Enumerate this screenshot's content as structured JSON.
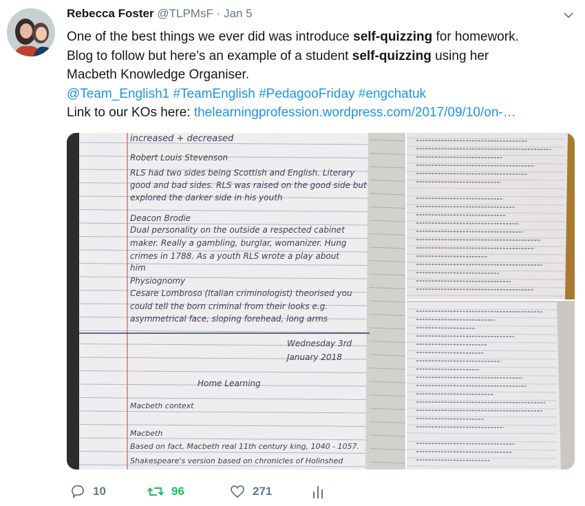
{
  "tweet": {
    "author_name": "Rebecca Foster",
    "author_handle": "@TLPMsF",
    "separator": "·",
    "date": "Jan 5",
    "lines": {
      "l1_pre": "One of the best things we ever did was introduce ",
      "l1_bold": "self-quizzing",
      "l1_post": " for homework.",
      "l2_pre": "Blog to follow but here’s an example of a student ",
      "l2_bold": "self-quizzing",
      "l2_post": " using her",
      "l3": "Macbeth Knowledge Organiser.",
      "hashtags": "@Team_English1 #TeamEnglish #PedagooFriday #engchatuk",
      "link_pre": "Link to our KOs here: ",
      "link_url": "thelearningprofession.wordpress.com/2017/09/10/on-…"
    }
  },
  "media": {
    "notebook_lines": [
      "increased + decreased",
      "Robert Louis Stevenson",
      "RLS had two sides being Scottish and English. Literary",
      "good and bad sides. RLS was raised on the good side but",
      "explored the darker side in his youth",
      "Deacon Brodie",
      "Dual personality on the outside a respected cabinet",
      "maker. Really a gambling, burglar, womanizer. Hung",
      "crimes in 1788. As a youth RLS wrote a play about",
      "him",
      "Physiognomy",
      "Cesare Lombroso (Italian criminologist) theorised you",
      "could tell the born criminal from their looks e.g.",
      "asymmetrical face, sloping forehead, long arms",
      "Wednesday 3rd",
      "January 2018",
      "Home Learning",
      "Macbeth context",
      "Macbeth",
      "Based on fact, Macbeth real 11th century king, 1040 - 1057.",
      "Shakespeare's version based on chronicles of Holinshed"
    ],
    "theme": {
      "paper": "#efedee",
      "rule": "#8aa6d6",
      "margin": "#d86a6a",
      "ink": "#3c3f52"
    }
  },
  "actions": {
    "reply_count": "10",
    "retweet_count": "96",
    "like_count": "271",
    "colors": {
      "default": "#657786",
      "retweet": "#17bf63"
    }
  }
}
